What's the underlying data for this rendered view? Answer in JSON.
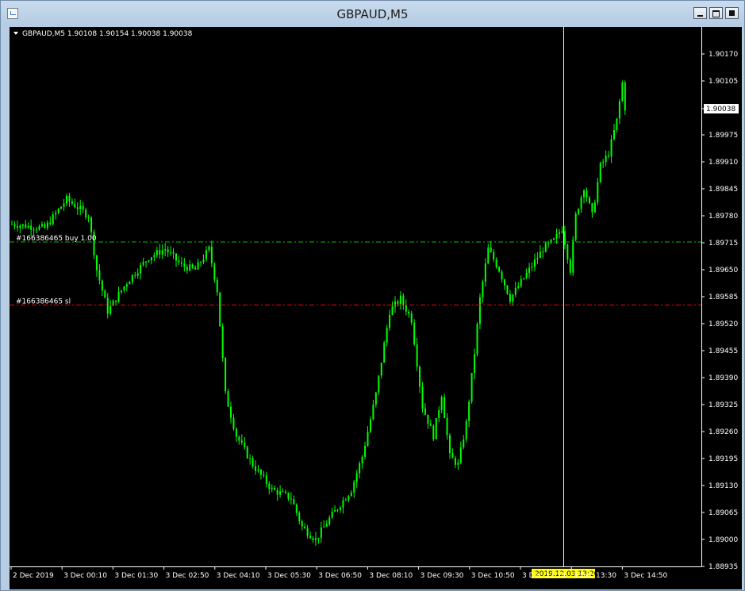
{
  "window": {
    "title": "GBPAUD,M5",
    "icon": "chart-window-icon",
    "buttons": [
      "minimize-icon",
      "restore-icon",
      "close-icon"
    ]
  },
  "chart_info": {
    "text": "GBPAUD,M5  1.90108 1.90154 1.90038 1.90038"
  },
  "colors": {
    "background": "#000000",
    "candle": "#00ff00",
    "buy_line": "#00c000",
    "sl_line": "#ff0000",
    "crosshair": "#ffffc0",
    "time_badge_bg": "#ffff00"
  },
  "price_axis": {
    "labels": [
      "1.90170",
      "1.90105",
      "1.90038",
      "1.89975",
      "1.89910",
      "1.89845",
      "1.89780",
      "1.89715",
      "1.89650",
      "1.89585",
      "1.89520",
      "1.89455",
      "1.89390",
      "1.89325",
      "1.89260",
      "1.89195",
      "1.89130",
      "1.89065",
      "1.89000",
      "1.88935"
    ],
    "current_price": "1.90038"
  },
  "time_axis": {
    "labels": [
      "2 Dec 2019",
      "3 Dec 00:10",
      "3 Dec 01:30",
      "3 Dec 02:50",
      "3 Dec 04:10",
      "3 Dec 05:30",
      "3 Dec 06:50",
      "3 Dec 08:10",
      "3 Dec 09:30",
      "3 Dec 10:50",
      "3 Dec 12:10",
      "3 Dec 13:30",
      "3 Dec 14:50"
    ],
    "crosshair_time": "2019.12.03 13:20"
  },
  "orders": {
    "buy_label": "#166386465 buy 1.00",
    "buy_price": 1.89717,
    "sl_label": "#166386465 sl",
    "sl_price": 1.89565
  },
  "chart_data": {
    "type": "candlestick",
    "symbol": "GBPAUD",
    "timeframe": "M5",
    "ylim": [
      1.88935,
      1.90235
    ],
    "keypoints_close": [
      [
        0,
        1.8976
      ],
      [
        12,
        1.8975
      ],
      [
        20,
        1.8982
      ],
      [
        28,
        1.8978
      ],
      [
        31,
        1.8965
      ],
      [
        35,
        1.8955
      ],
      [
        42,
        1.8962
      ],
      [
        50,
        1.8968
      ],
      [
        56,
        1.897
      ],
      [
        62,
        1.8966
      ],
      [
        67,
        1.8965
      ],
      [
        72,
        1.897
      ],
      [
        75,
        1.896
      ],
      [
        78,
        1.8935
      ],
      [
        82,
        1.8925
      ],
      [
        88,
        1.8918
      ],
      [
        95,
        1.8912
      ],
      [
        102,
        1.891
      ],
      [
        106,
        1.8903
      ],
      [
        111,
        1.89
      ],
      [
        116,
        1.8905
      ],
      [
        124,
        1.8912
      ],
      [
        128,
        1.892
      ],
      [
        133,
        1.8935
      ],
      [
        138,
        1.8955
      ],
      [
        142,
        1.8958
      ],
      [
        146,
        1.8953
      ],
      [
        150,
        1.8932
      ],
      [
        154,
        1.8925
      ],
      [
        157,
        1.8935
      ],
      [
        160,
        1.892
      ],
      [
        163,
        1.8918
      ],
      [
        166,
        1.8928
      ],
      [
        169,
        1.8945
      ],
      [
        171,
        1.8958
      ],
      [
        174,
        1.897
      ],
      [
        178,
        1.8965
      ],
      [
        182,
        1.8958
      ],
      [
        186,
        1.8962
      ],
      [
        190,
        1.8966
      ],
      [
        194,
        1.897
      ],
      [
        198,
        1.8972
      ],
      [
        201,
        1.8975
      ],
      [
        204,
        1.8965
      ],
      [
        206,
        1.8978
      ],
      [
        209,
        1.8985
      ],
      [
        212,
        1.8978
      ],
      [
        215,
        1.899
      ],
      [
        218,
        1.8993
      ],
      [
        221,
        1.9001
      ],
      [
        223,
        1.901
      ],
      [
        224,
        1.9004
      ]
    ]
  }
}
